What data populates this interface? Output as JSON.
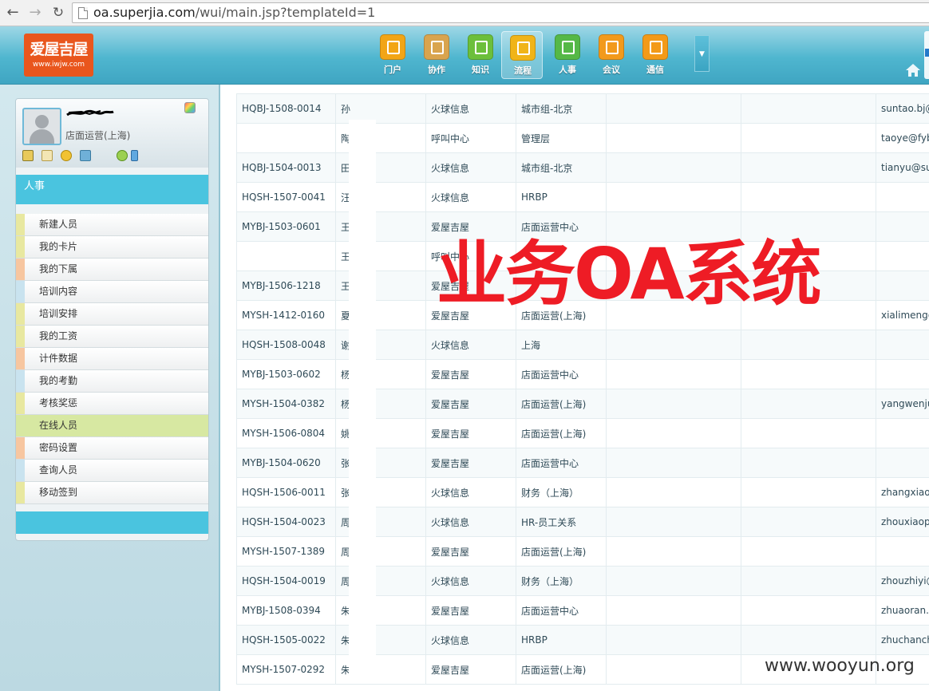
{
  "browser": {
    "url_host": "oa.superjia.com",
    "url_path": "/wui/main.jsp?templateId=1"
  },
  "header": {
    "logo_text": "爱屋吉屋",
    "logo_sub": "www.iwjw.com",
    "modules": [
      {
        "label": "门户",
        "icon": "home-icon",
        "color": "#f2a516"
      },
      {
        "label": "协作",
        "icon": "clipboard-icon",
        "color": "#d9a44e"
      },
      {
        "label": "知识",
        "icon": "database-icon",
        "color": "#6cbf3b"
      },
      {
        "label": "流程",
        "icon": "bar-chart-icon",
        "color": "#f0b418"
      },
      {
        "label": "人事",
        "icon": "card-icon",
        "color": "#55b847"
      },
      {
        "label": "会议",
        "icon": "phone-icon",
        "color": "#f29a1c"
      },
      {
        "label": "通信",
        "icon": "mobile-icon",
        "color": "#f39a18"
      }
    ],
    "active_module": "流程"
  },
  "sidebar": {
    "user_dept": "店面运营(上海)",
    "section_title": "人事",
    "items": [
      {
        "label": "新建人员",
        "accent": "#e8e8a0"
      },
      {
        "label": "我的卡片",
        "accent": "#e8e8a0"
      },
      {
        "label": "我的下属",
        "accent": "#f7c6a0"
      },
      {
        "label": "培训内容",
        "accent": "#c9e3ef"
      },
      {
        "label": "培训安排",
        "accent": "#e8e8a0"
      },
      {
        "label": "我的工资",
        "accent": "#e8e8a0"
      },
      {
        "label": "计件数据",
        "accent": "#f7c6a0"
      },
      {
        "label": "我的考勤",
        "accent": "#c9e3ef"
      },
      {
        "label": "考核奖惩",
        "accent": "#e8e8a0"
      },
      {
        "label": "在线人员",
        "accent": "#d7e8a2"
      },
      {
        "label": "密码设置",
        "accent": "#f7c6a0"
      },
      {
        "label": "查询人员",
        "accent": "#c9e3ef"
      },
      {
        "label": "移动签到",
        "accent": "#e8e8a0"
      }
    ],
    "active_item": "在线人员"
  },
  "table": {
    "rows": [
      {
        "code": "HQBJ-1508-0014",
        "name": "孙",
        "company": "火球信息",
        "dept": "城市组-北京",
        "email": "suntao.bj@"
      },
      {
        "code": "",
        "name": "陶",
        "company": "呼叫中心",
        "dept": "管理层",
        "email": "taoye@fyb"
      },
      {
        "code": "HQBJ-1504-0013",
        "name": "田",
        "company": "火球信息",
        "dept": "城市组-北京",
        "email": "tianyu@su"
      },
      {
        "code": "HQSH-1507-0041",
        "name": "汪",
        "company": "火球信息",
        "dept": "HRBP",
        "email": ""
      },
      {
        "code": "MYBJ-1503-0601",
        "name": "王",
        "company": "爱屋吉屋",
        "dept": "店面运营中心",
        "email": ""
      },
      {
        "code": "",
        "name": "王",
        "company": "呼叫中心",
        "dept": "",
        "email": ""
      },
      {
        "code": "MYBJ-1506-1218",
        "name": "王",
        "company": "爱屋吉屋",
        "dept": "",
        "email": ""
      },
      {
        "code": "MYSH-1412-0160",
        "name": "夏",
        "company": "爱屋吉屋",
        "dept": "店面运营(上海)",
        "email": "xialimeng@"
      },
      {
        "code": "HQSH-1508-0048",
        "name": "谢",
        "company": "火球信息",
        "dept": "上海",
        "email": ""
      },
      {
        "code": "MYBJ-1503-0602",
        "name": "杨",
        "company": "爱屋吉屋",
        "dept": "店面运营中心",
        "email": ""
      },
      {
        "code": "MYSH-1504-0382",
        "name": "杨",
        "company": "爱屋吉屋",
        "dept": "店面运营(上海)",
        "email": "yangwenju"
      },
      {
        "code": "MYSH-1506-0804",
        "name": "姚",
        "company": "爱屋吉屋",
        "dept": "店面运营(上海)",
        "email": ""
      },
      {
        "code": "MYBJ-1504-0620",
        "name": "张",
        "company": "爱屋吉屋",
        "dept": "店面运营中心",
        "email": ""
      },
      {
        "code": "HQSH-1506-0011",
        "name": "张",
        "company": "火球信息",
        "dept": "财务（上海）",
        "email": "zhangxiaov"
      },
      {
        "code": "HQSH-1504-0023",
        "name": "周",
        "company": "火球信息",
        "dept": "HR-员工关系",
        "email": "zhouxiaopi"
      },
      {
        "code": "MYSH-1507-1389",
        "name": "周",
        "company": "爱屋吉屋",
        "dept": "店面运营(上海)",
        "email": ""
      },
      {
        "code": "HQSH-1504-0019",
        "name": "周",
        "company": "火球信息",
        "dept": "财务（上海）",
        "email": "zhouzhiyi@"
      },
      {
        "code": "MYBJ-1508-0394",
        "name": "朱",
        "company": "爱屋吉屋",
        "dept": "店面运营中心",
        "email": "zhuaoran.b"
      },
      {
        "code": "HQSH-1505-0022",
        "name": "朱",
        "company": "火球信息",
        "dept": "HRBP",
        "email": "zhuchanch"
      },
      {
        "code": "MYSH-1507-0292",
        "name": "朱",
        "company": "爱屋吉屋",
        "dept": "店面运营(上海)",
        "email": ""
      }
    ]
  },
  "overlay": {
    "title": "业务OA系统",
    "watermark": "www.wooyun.org"
  }
}
